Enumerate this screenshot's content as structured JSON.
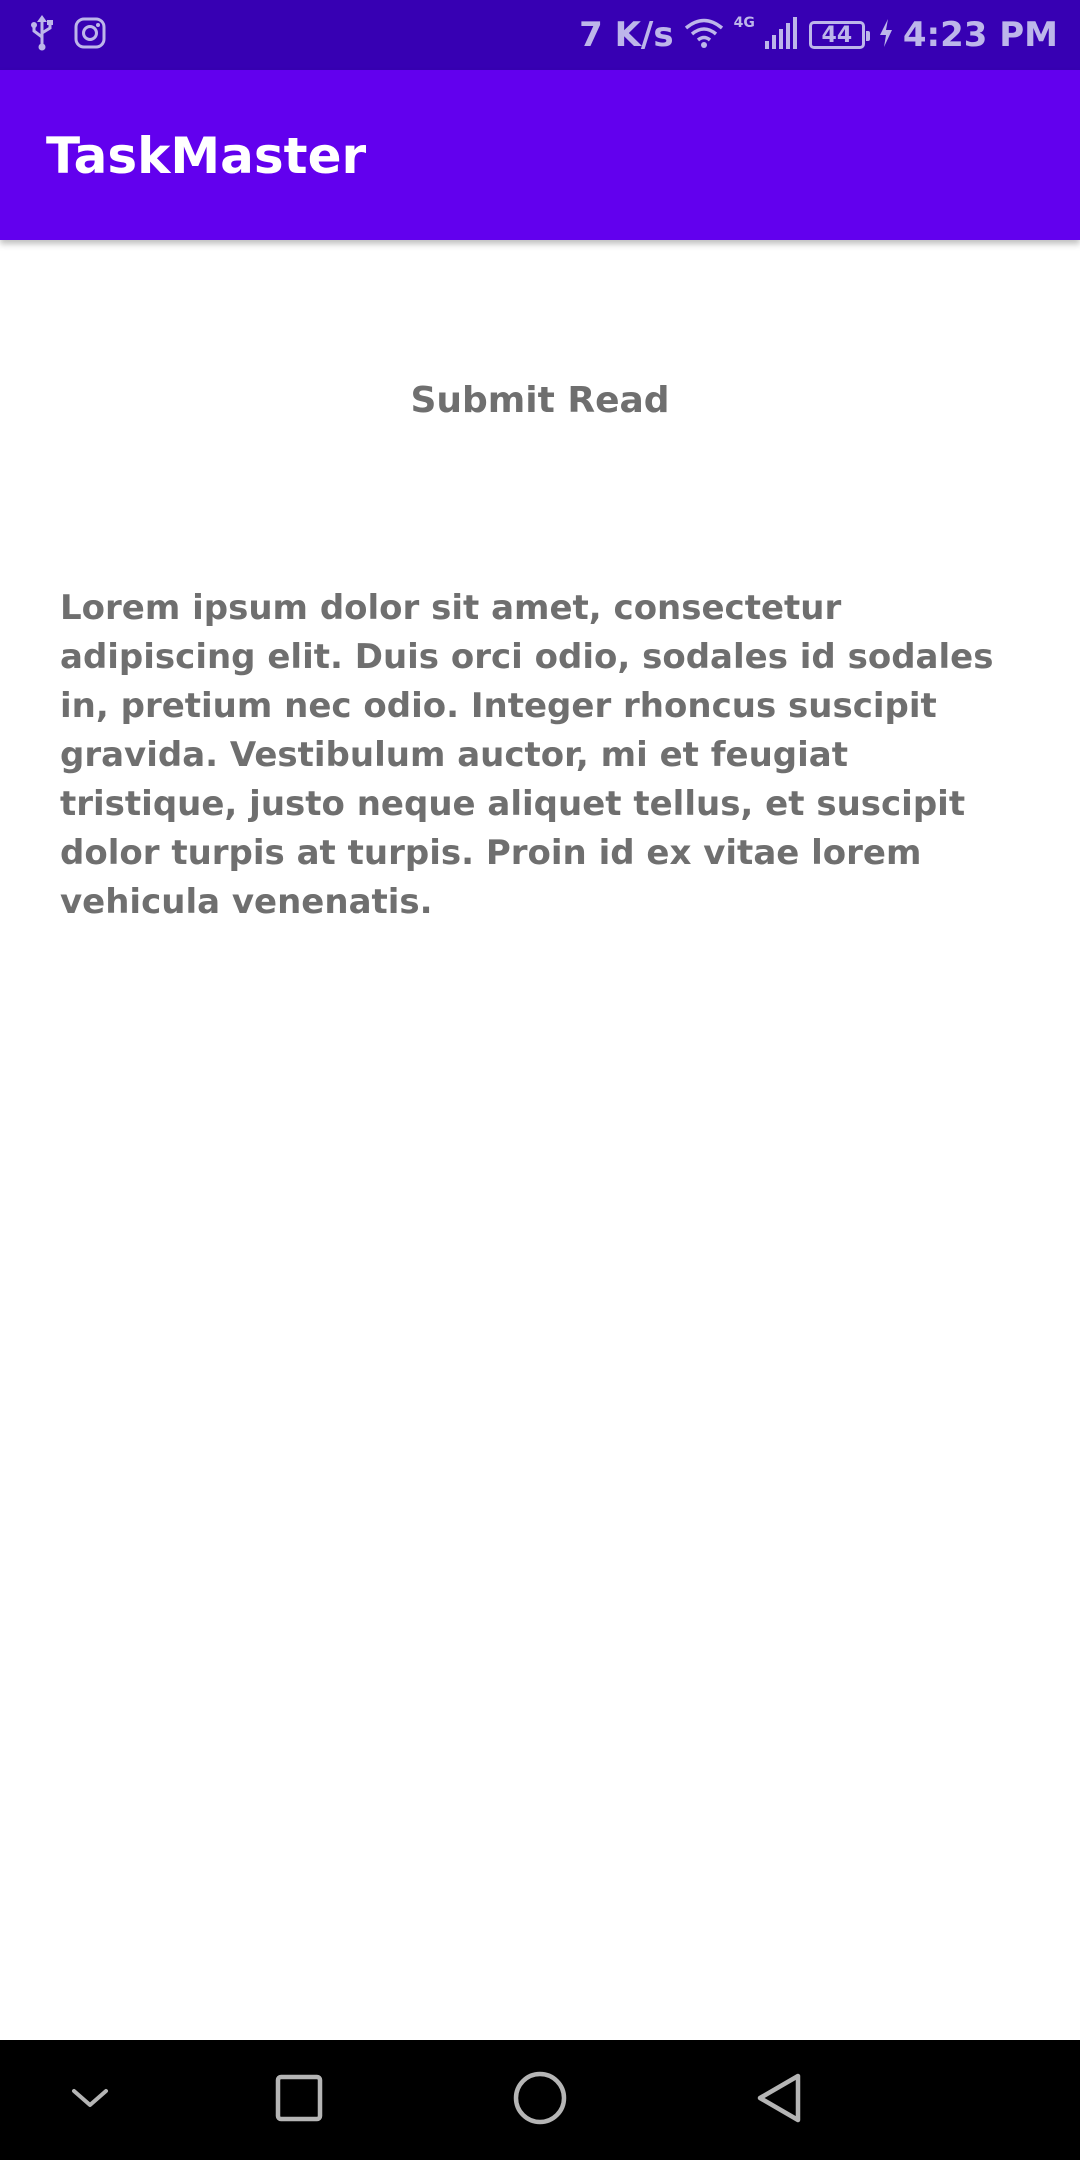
{
  "status_bar": {
    "network_speed": "7 K/s",
    "network_type": "4G",
    "battery_level": "44",
    "time": "4:23 PM",
    "icons": [
      "usb-icon",
      "instagram-icon",
      "wifi-icon",
      "signal-icon",
      "battery-icon",
      "charging-icon"
    ]
  },
  "app_bar": {
    "title": "TaskMaster"
  },
  "main": {
    "submit_label": "Submit Read",
    "body_text": "Lorem ipsum dolor sit amet, consectetur adipiscing elit. Duis orci odio, sodales id sodales in, pretium nec odio. Integer rhoncus suscipit gravida. Vestibulum auctor, mi et feugiat tristique, justo neque aliquet tellus, et suscipit dolor turpis at turpis. Proin id ex vitae lorem vehicula venenatis."
  },
  "nav_bar": {
    "icons": [
      "chevron-down-icon",
      "recents-icon",
      "home-icon",
      "back-icon"
    ]
  },
  "colors": {
    "status_bar": "#3700b3",
    "app_bar": "#6200ee",
    "text_gray": "#6f6f6f",
    "nav_bar": "#000000"
  }
}
